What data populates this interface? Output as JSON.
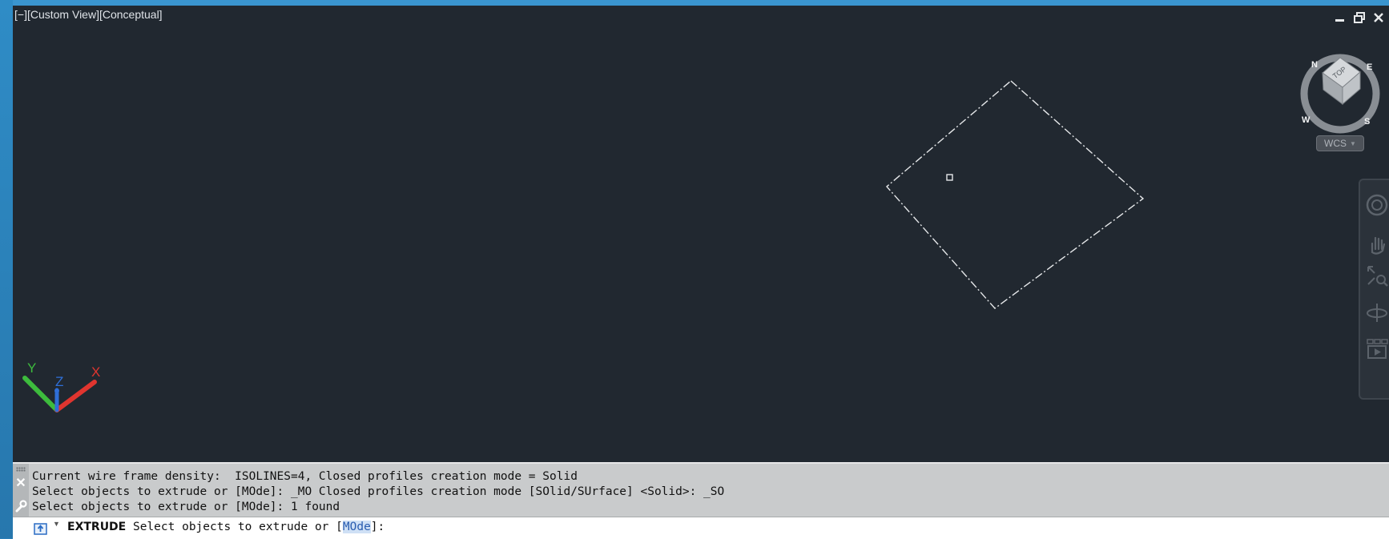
{
  "viewport": {
    "minus_control": "[−]",
    "view_name": "[Custom View]",
    "visual_style": "[Conceptual]"
  },
  "viewcube": {
    "top_face": "TOP",
    "compass": {
      "n": "N",
      "e": "E",
      "s": "S",
      "w": "W"
    },
    "wcs_label": "WCS"
  },
  "ucs": {
    "x": "X",
    "y": "Y",
    "z": "Z"
  },
  "command_history": [
    "Current wire frame density:  ISOLINES=4, Closed profiles creation mode = Solid",
    "Select objects to extrude or [MOde]: _MO Closed profiles creation mode [SOlid/SUrface] <Solid>: _SO",
    "Select objects to extrude or [MOde]: 1 found"
  ],
  "command_input": {
    "command": "EXTRUDE",
    "prompt_before": " Select objects to extrude or [",
    "option": "MOde",
    "prompt_after": "]:"
  },
  "colors": {
    "viewport_bg": "#212830",
    "axis_x": "#e0352f",
    "axis_y": "#3dbb3d",
    "axis_z": "#2f6fd8"
  }
}
